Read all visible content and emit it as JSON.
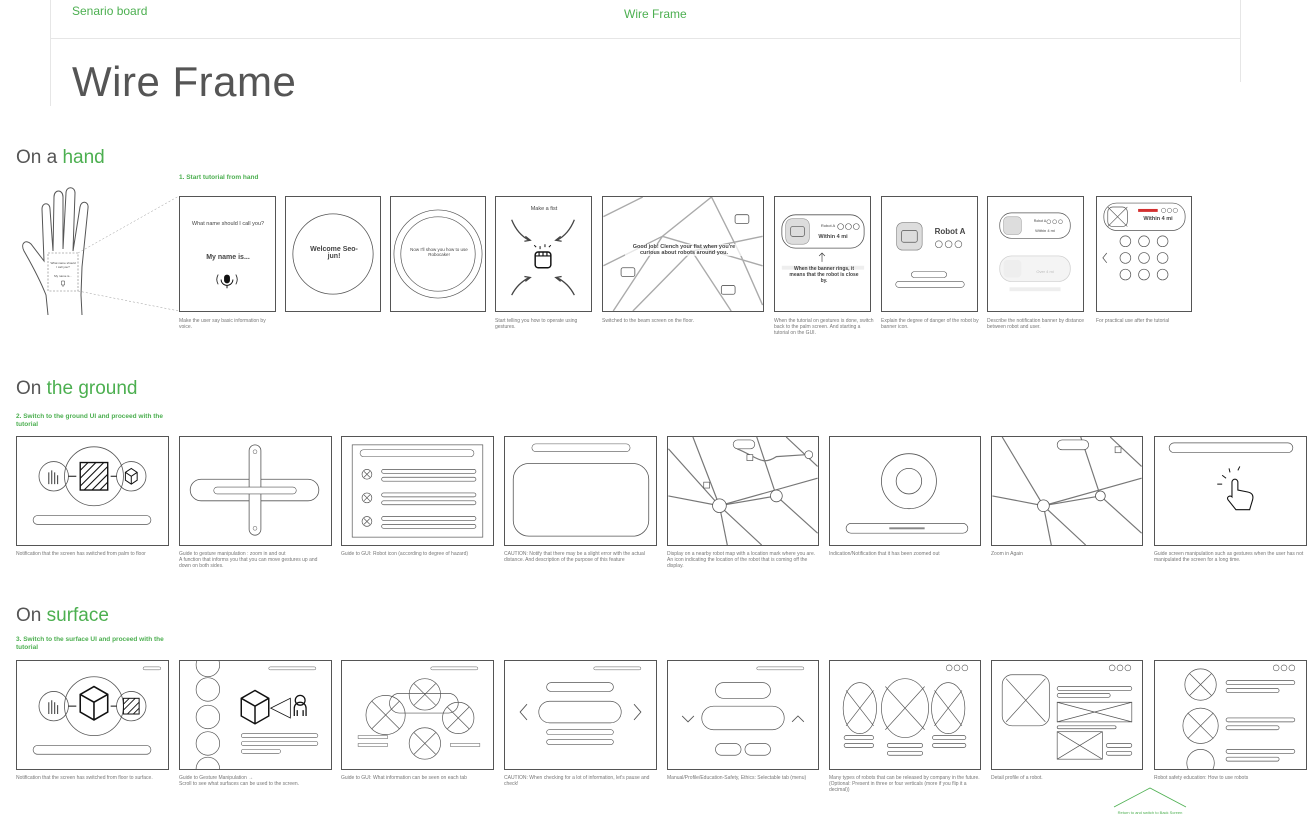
{
  "nav": {
    "left_link": "Senario board",
    "center_link": "Wire Frame"
  },
  "page_title": "Wire Frame",
  "sections": {
    "hand": {
      "title_prefix": "On a ",
      "title_accent": "hand",
      "step": "1. Start tutorial from hand",
      "palm": {
        "line1": "What name should I call you?",
        "line2": "My name is..."
      },
      "frames": {
        "f1": {
          "question": "What name should I call you?",
          "answer": "My name is..."
        },
        "f2": {
          "text": "Welcome Seo-jun!"
        },
        "f3": {
          "text": "Now I'll show you how to use Robocake!"
        },
        "f4": {
          "text": "Make a fist"
        },
        "f5": {
          "text": "Good job! Clench your fist when you're curious about robots around you."
        },
        "f6": {
          "name": "Robot A",
          "distance": "Within 4 mi",
          "note": "When the banner rings, it means that the robot is close by."
        },
        "f7": {
          "name": "Robot A"
        },
        "f8": {
          "name": "Robot A",
          "distance": "Within 4 mi",
          "far": "Over 4 mi"
        },
        "f9": {
          "distance": "Within 4 mi"
        }
      },
      "captions": [
        "Make the user say basic information by voice.",
        "",
        "",
        "Start telling you how to operate using gestures.",
        "Switched to the beam screen on the floor.",
        "When the tutorial on gestures is done, switch back to the palm screen. And starting a tutorial on the GUI.",
        "Explain the degree of danger of the robot by banner icon.",
        "Describe the notification banner by distance between robot and user.",
        "For practical use after the tutorial"
      ]
    },
    "ground": {
      "title_prefix": "On ",
      "title_accent": "the ground",
      "step": "2. Switch to the ground UI and proceed with the tutorial",
      "captions": [
        "Notification that the screen has switched from palm to floor",
        "Guide to gesture manipulation : zoom in and out\nA function that informs you that you can move gestures up and down on both sides.",
        "Guide to GUI: Robot icon (according to degree of hazard)",
        "CAUTION: Notify that there may be a slight error with the actual distance. And description of the purpose of this feature",
        "Display on a nearby robot map with a location mark where you are. An icon indicating the location of the robot that is coming off the display.",
        "Indication/Notification that it has been zoomed out",
        "Zoom in Again",
        "Guide screen manipulation such as gestures when the user has not manipulated the screen for a long time."
      ]
    },
    "surface": {
      "title_prefix": "On ",
      "title_accent": "surface",
      "step": "3. Switch to the surface UI and proceed with the tutorial",
      "captions": [
        "Notification that the screen has switched from floor to surface.",
        "Guide to Gesture Manipulation →\nScroll to see what surfaces can be used to the screen.",
        "Guide to GUI: What information can be seen on each tab",
        "CAUTION: When checking for a lot of information, let's pause and check!",
        "Manual/Profile/Education-Safety, Ethics: Selectable tab (menu)",
        "Many types of robots that can be released by company in the future.\n(Optional: Present in three or four verticals (more if you flip it a decimal))",
        "Detail profile of a robot.",
        "Robot safety education: How to use robots"
      ]
    }
  },
  "footer_note": "Return to and switch to Back Screen",
  "colors": {
    "accent": "#4caf50",
    "danger": "#d32f2f",
    "stroke": "#555555"
  }
}
